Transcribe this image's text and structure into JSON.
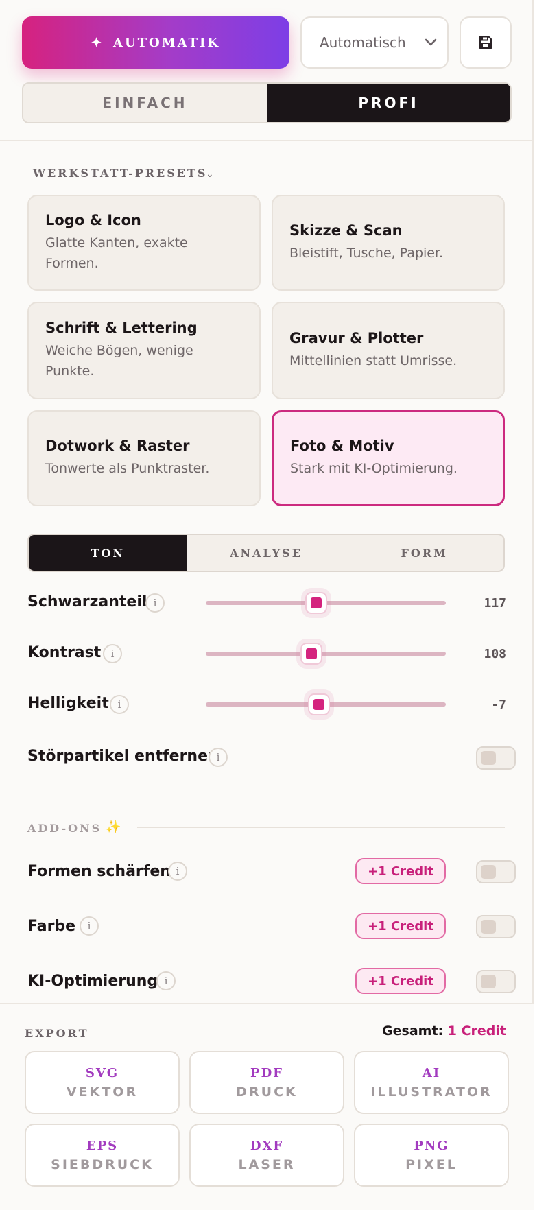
{
  "toolbar": {
    "auto_label": "AUTOMATIK",
    "mode_value": "Automatisch",
    "save_icon": "save-icon"
  },
  "level": {
    "options": [
      "EINFACH",
      "PROFI"
    ],
    "selected": "PROFI"
  },
  "presets": {
    "label": "WERKSTATT-PRESETS",
    "items": [
      {
        "title": "Logo & Icon",
        "desc": "Glatte Kanten, exakte Formen.",
        "selected": false
      },
      {
        "title": "Skizze & Scan",
        "desc": "Bleistift, Tusche, Papier.",
        "selected": false
      },
      {
        "title": "Schrift & Lettering",
        "desc": "Weiche Bögen, wenige Punkte.",
        "selected": false
      },
      {
        "title": "Gravur & Plotter",
        "desc": "Mittellinien statt Umrisse.",
        "selected": false
      },
      {
        "title": "Dotwork & Raster",
        "desc": "Tonwerte als Punktraster.",
        "selected": false
      },
      {
        "title": "Foto & Motiv",
        "desc": "Stark mit KI-Optimierung.",
        "selected": true
      }
    ]
  },
  "tabs": {
    "items": [
      "TON",
      "ANALYSE",
      "FORM"
    ],
    "active": "TON"
  },
  "sliders": [
    {
      "label": "Schwarzanteil",
      "value": "117",
      "fraction": 0.46
    },
    {
      "label": "Kontrast",
      "value": "108",
      "fraction": 0.44
    },
    {
      "label": "Helligkeit",
      "value": "-7",
      "fraction": 0.47
    }
  ],
  "noise": {
    "label": "Störpartikel entfernen",
    "on": false
  },
  "addons": {
    "label": "ADD-ONS",
    "items": [
      {
        "label": "Formen schärfen",
        "credit": "+1 Credit",
        "on": false
      },
      {
        "label": "Farbe",
        "credit": "+1 Credit",
        "on": false
      },
      {
        "label": "KI-Optimierung",
        "credit": "+1 Credit",
        "on": false
      }
    ]
  },
  "export": {
    "label": "EXPORT",
    "total_label": "Gesamt:",
    "total_value": "1 Credit",
    "formats": [
      {
        "format": "SVG",
        "sub": "VEKTOR"
      },
      {
        "format": "PDF",
        "sub": "DRUCK"
      },
      {
        "format": "AI",
        "sub": "ILLUSTRATOR"
      },
      {
        "format": "EPS",
        "sub": "SIEBDRUCK"
      },
      {
        "format": "DXF",
        "sub": "LASER"
      },
      {
        "format": "PNG",
        "sub": "PIXEL"
      }
    ]
  },
  "colors": {
    "accent": "#d4237e",
    "dark": "#1b1518",
    "brand_gradient_end": "#7d3ee6"
  }
}
